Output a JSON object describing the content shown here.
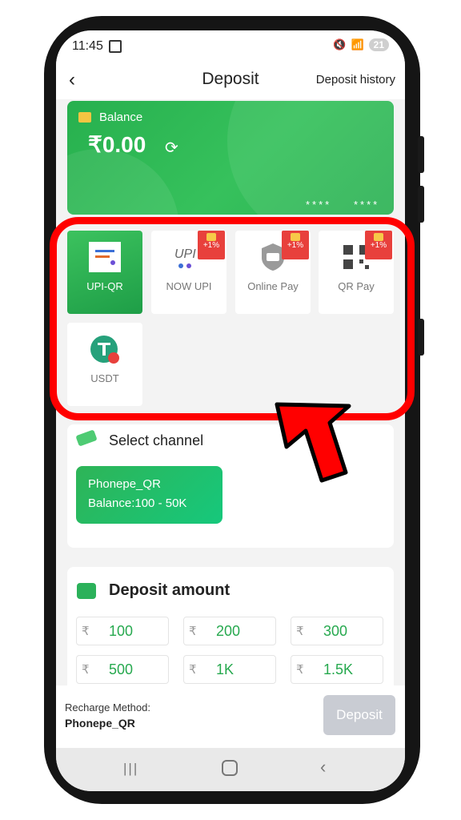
{
  "status": {
    "time": "11:45",
    "battery": "21"
  },
  "header": {
    "title": "Deposit",
    "history_link": "Deposit history"
  },
  "balance": {
    "label": "Balance",
    "amount": "₹0.00",
    "masked_1": "****",
    "masked_2": "****"
  },
  "methods": [
    {
      "label": "UPI-QR",
      "active": true,
      "promo": ""
    },
    {
      "label": "NOW UPI",
      "active": false,
      "promo": "+1%"
    },
    {
      "label": "Online Pay",
      "active": false,
      "promo": "+1%"
    },
    {
      "label": "QR Pay",
      "active": false,
      "promo": "+1%"
    },
    {
      "label": "USDT",
      "active": false,
      "promo": ""
    }
  ],
  "channel": {
    "title": "Select channel",
    "name": "Phonepe_QR",
    "range": "Balance:100 - 50K"
  },
  "amount": {
    "title": "Deposit amount",
    "currency": "₹",
    "options": [
      "100",
      "200",
      "300",
      "500",
      "1K",
      "1.5K"
    ]
  },
  "footer": {
    "recharge_label": "Recharge Method:",
    "recharge_value": "Phonepe_QR",
    "deposit_label": "Deposit"
  },
  "colors": {
    "brand_green": "#2bb15a",
    "highlight": "#ff0000",
    "promo": "#e8403c"
  }
}
